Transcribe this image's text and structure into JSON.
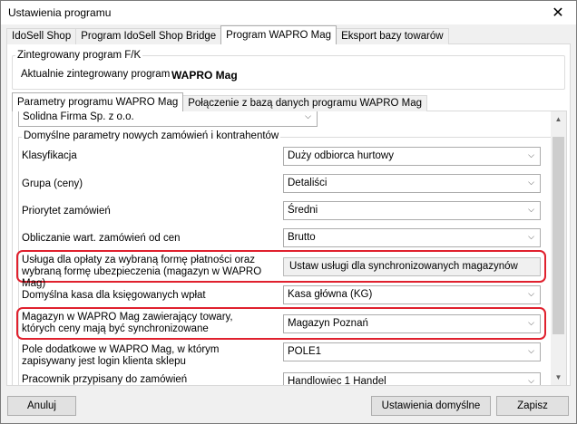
{
  "window": {
    "title": "Ustawienia programu",
    "close_glyph": "✕"
  },
  "top_tabs": [
    "IdoSell Shop",
    "Program IdoSell Shop Bridge",
    "Program WAPRO Mag",
    "Eksport bazy towarów"
  ],
  "integrated": {
    "legend": "Zintegrowany program F/K",
    "label": "Aktualnie zintegrowany program",
    "value": "WAPRO Mag"
  },
  "inner_tabs": [
    "Parametry programu  WAPRO Mag",
    "Połączenie z bazą danych programu WAPRO Mag"
  ],
  "company_select": "Solidna Firma Sp. z o.o.",
  "section_legend": "Domyślne parametry nowych zamówień i kontrahentów",
  "fields": {
    "klasyfikacja": {
      "label": "Klasyfikacja",
      "value": "Duży odbiorca hurtowy"
    },
    "grupa": {
      "label": "Grupa (ceny)",
      "value": "Detaliści"
    },
    "priorytet": {
      "label": "Priorytet zamówień",
      "value": "Średni"
    },
    "obliczanie": {
      "label": "Obliczanie wart. zamówień od cen",
      "value": "Brutto"
    },
    "usluga": {
      "label": "Usługa dla opłaty za wybraną formę płatności oraz wybraną formę ubezpieczenia (magazyn w WAPRO Mag)",
      "button": "Ustaw usługi dla synchronizowanych magazynów"
    },
    "kasa": {
      "label": "Domyślna kasa dla księgowanych wpłat",
      "value": "Kasa główna (KG)"
    },
    "magazyn": {
      "label": "Magazyn w WAPRO Mag zawierający towary, których ceny mają być synchronizowane",
      "value": "Magazyn Poznań"
    },
    "pole": {
      "label": "Pole dodatkowe w WAPRO Mag, w którym zapisywany jest login klienta sklepu",
      "value": "POLE1"
    },
    "pracownik": {
      "label": "Pracownik przypisany do zamówień",
      "value": "Handlowiec 1 Handel"
    }
  },
  "buttons": {
    "cancel": "Anuluj",
    "defaults": "Ustawienia domyślne",
    "save": "Zapisz"
  },
  "highlight_color": "#e0212e"
}
